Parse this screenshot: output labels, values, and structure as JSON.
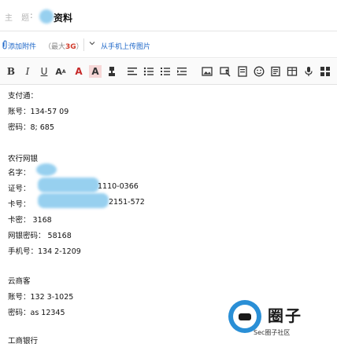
{
  "subject": {
    "label": "主 题",
    "colon": ":",
    "value": "资料"
  },
  "attachments": {
    "add_label": "添加附件",
    "limit_prefix": "（最大",
    "limit_value": "3G",
    "limit_suffix": "）",
    "upload_label": "从手机上传图片"
  },
  "toolbar": {
    "items": [
      "bold-icon",
      "italic-icon",
      "underline-icon",
      "font-size-icon",
      "font-color-icon",
      "highlight-icon",
      "format-brush-icon",
      "align-left-icon",
      "unordered-list-icon",
      "ordered-list-icon",
      "indent-icon",
      "image-icon",
      "screenshot-icon",
      "document-icon",
      "emoji-icon",
      "note-icon",
      "table-icon",
      "voice-icon",
      "code-icon",
      "grid-icon"
    ]
  },
  "body": {
    "lines": [
      "支付通：",
      "账号：134-57        09",
      "密码：8;   685",
      "农行网银",
      "名字：",
      "证号：",
      "1110-0366",
      "卡号：",
      "2151-572",
      "卡密：   3168",
      "网银密码：     58168",
      "手机号：134      2-1209",
      "云商客",
      "账号：132       3-1025",
      "密码：as       12345",
      "工商银行"
    ]
  },
  "watermark": {
    "brand": "圈子",
    "sub": "Sec圈子社区"
  },
  "colors": {
    "link": "#1e67c8",
    "limit": "#d03a2a",
    "redaction": "#8ccbee",
    "badge": "#2a8fd6"
  }
}
